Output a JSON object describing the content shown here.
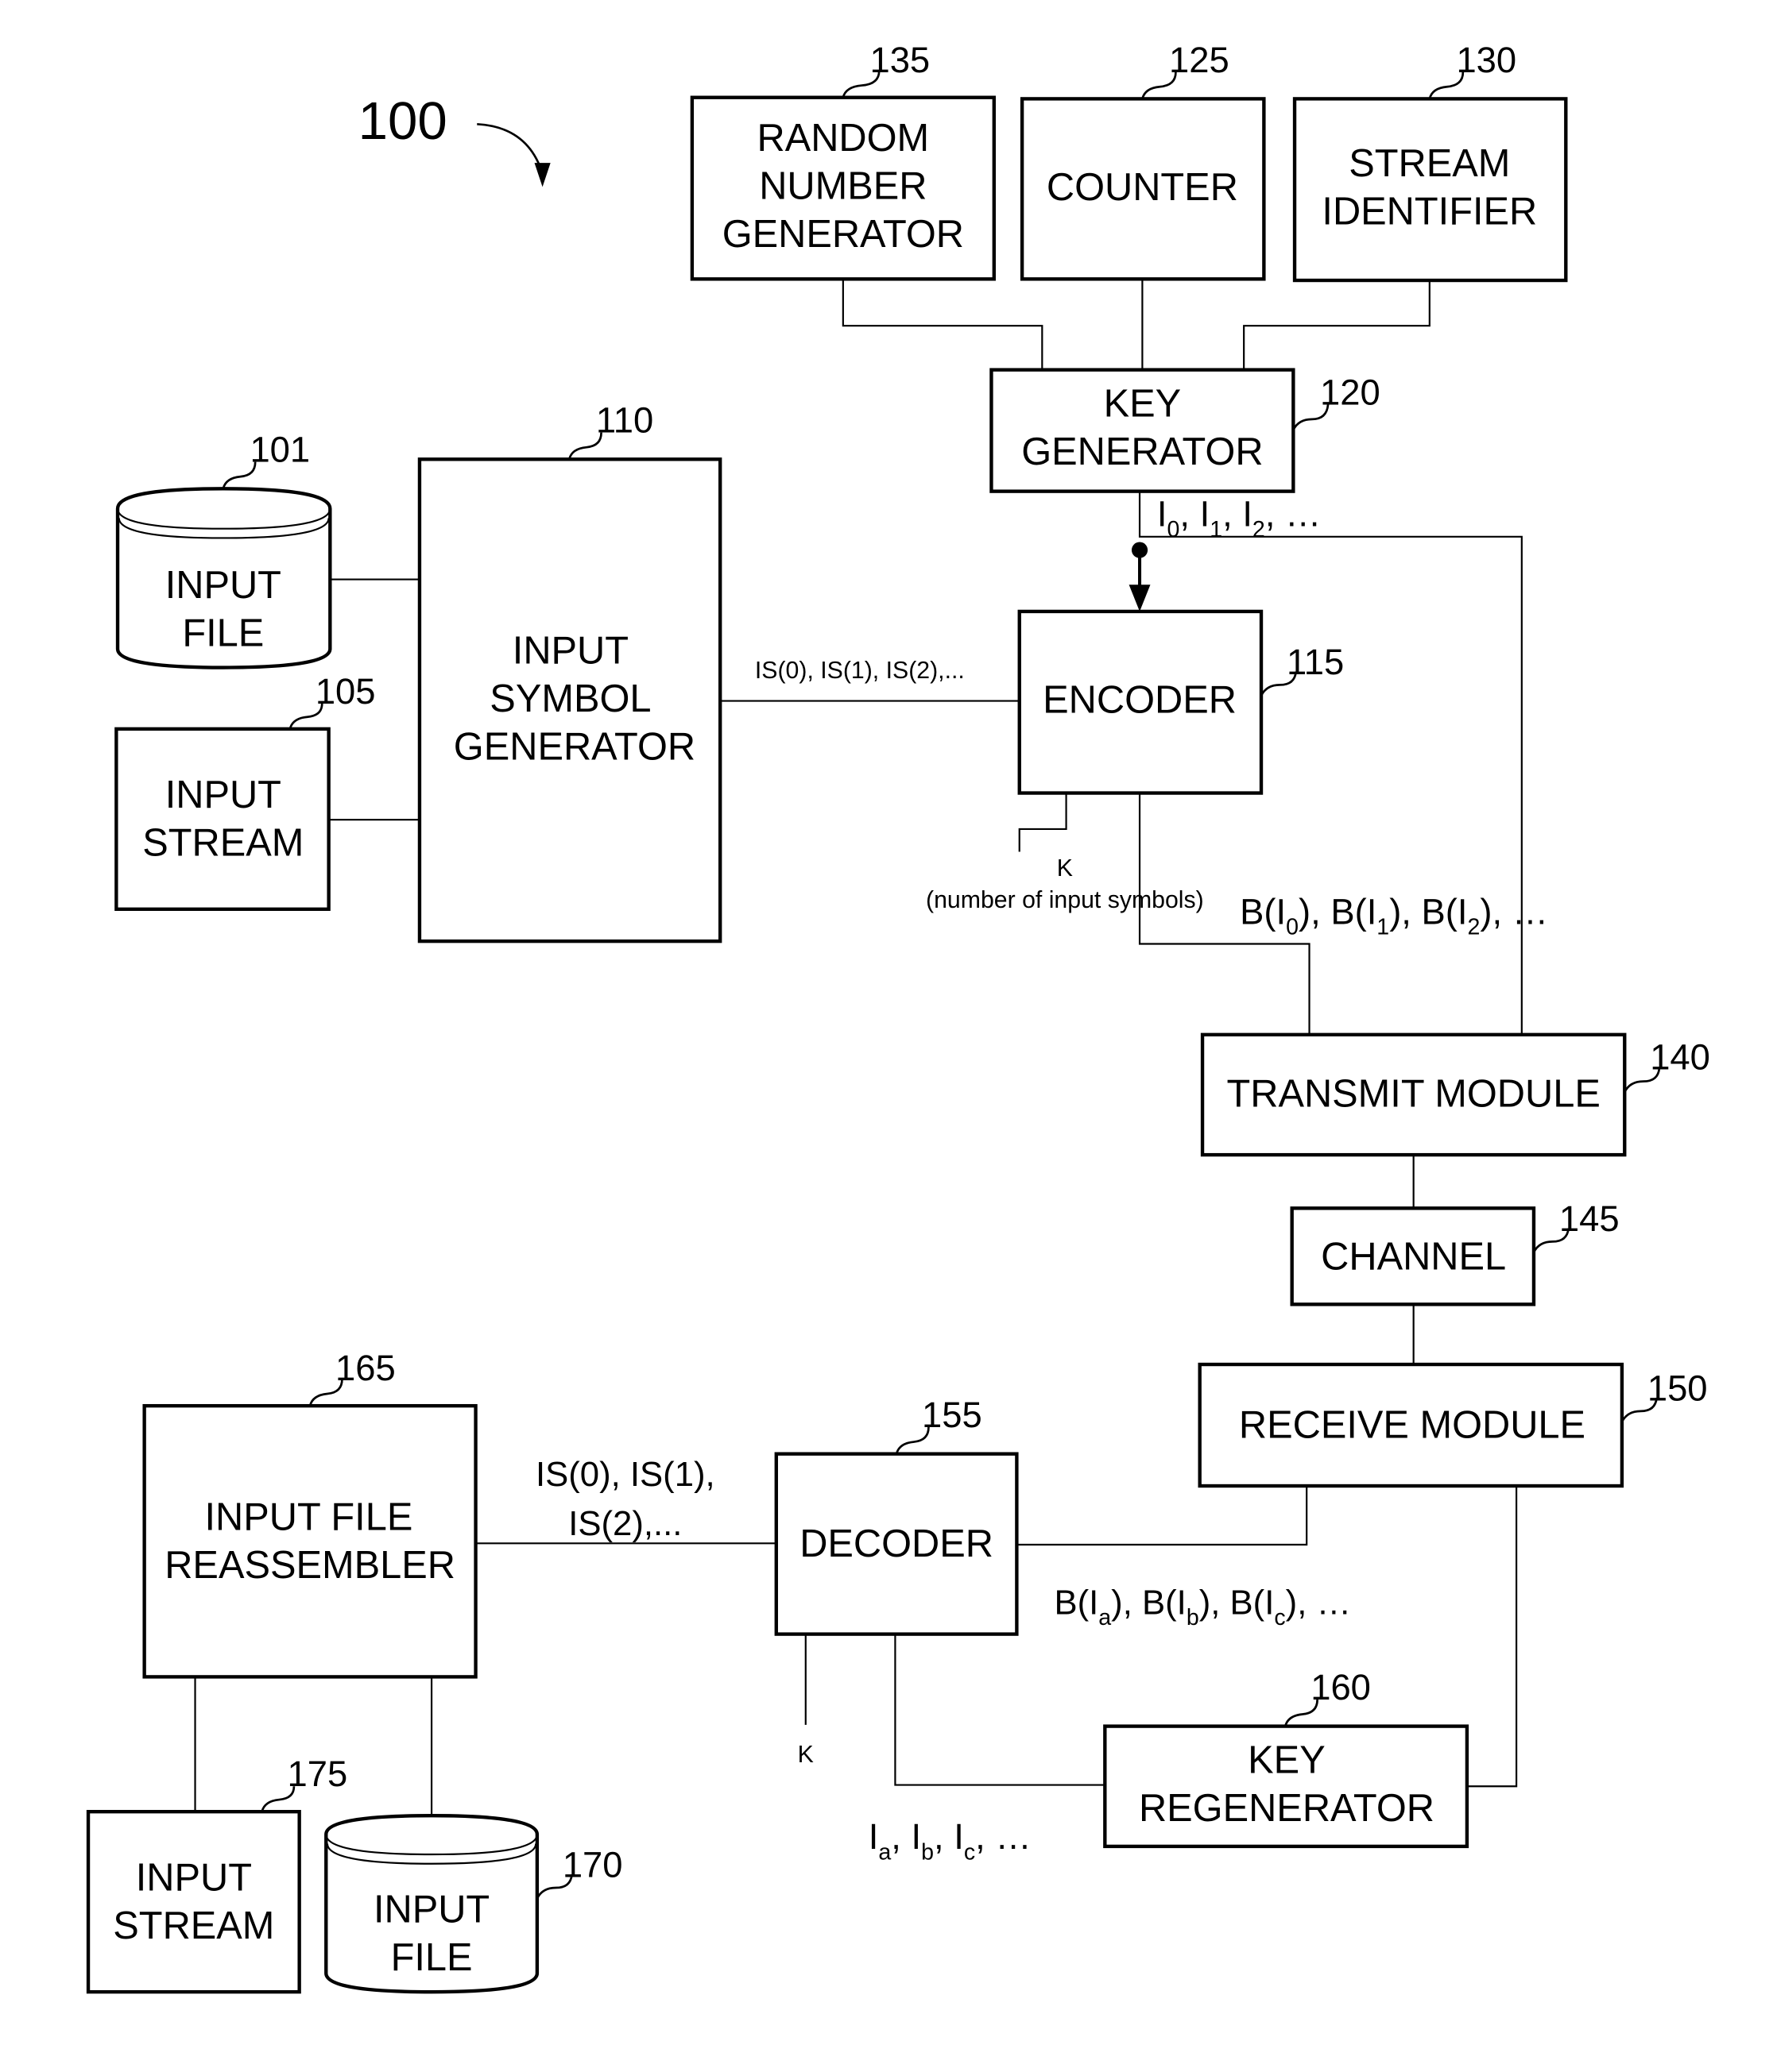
{
  "figure": {
    "ref": "100"
  },
  "blocks": {
    "rng": {
      "ref": "135",
      "lines": [
        "RANDOM",
        "NUMBER",
        "GENERATOR"
      ]
    },
    "counter": {
      "ref": "125",
      "lines": [
        "COUNTER"
      ]
    },
    "stream_id": {
      "ref": "130",
      "lines": [
        "STREAM",
        "IDENTIFIER"
      ]
    },
    "key_gen": {
      "ref": "120",
      "lines": [
        "KEY",
        "GENERATOR"
      ]
    },
    "input_file": {
      "ref": "101",
      "lines": [
        "INPUT",
        "FILE"
      ]
    },
    "input_stream": {
      "ref": "105",
      "lines": [
        "INPUT",
        "STREAM"
      ]
    },
    "symbol_gen": {
      "ref": "110",
      "lines": [
        "INPUT",
        "SYMBOL",
        "GENERATOR"
      ]
    },
    "encoder": {
      "ref": "115",
      "lines": [
        "ENCODER"
      ]
    },
    "transmit": {
      "ref": "140",
      "lines": [
        "TRANSMIT MODULE"
      ]
    },
    "channel": {
      "ref": "145",
      "lines": [
        "CHANNEL"
      ]
    },
    "receive": {
      "ref": "150",
      "lines": [
        "RECEIVE MODULE"
      ]
    },
    "decoder": {
      "ref": "155",
      "lines": [
        "DECODER"
      ]
    },
    "key_regen": {
      "ref": "160",
      "lines": [
        "KEY",
        "REGENERATOR"
      ]
    },
    "reassembler": {
      "ref": "165",
      "lines": [
        "INPUT FILE",
        "REASSEMBLER"
      ]
    },
    "out_stream": {
      "ref": "175",
      "lines": [
        "INPUT",
        "STREAM"
      ]
    },
    "out_file": {
      "ref": "170",
      "lines": [
        "INPUT",
        "FILE"
      ]
    }
  },
  "signals": {
    "keys_tx": {
      "base": "I",
      "subs": [
        "0",
        "1",
        "2"
      ],
      "tail": "…"
    },
    "symbols_tx": "IS(0), IS(1), IS(2),...",
    "k_label": "K",
    "k_desc": "(number of input symbols)",
    "encoded": {
      "prefix": "B(I",
      "subs": [
        "0",
        "1",
        "2"
      ],
      "tail": "…"
    },
    "symbols_rx": [
      "IS(0), IS(1),",
      "IS(2),..."
    ],
    "received": {
      "subs": [
        "a",
        "b",
        "c"
      ],
      "tail": "…"
    },
    "keys_rx": {
      "subs": [
        "a",
        "b",
        "c"
      ],
      "tail": "…"
    },
    "k_rx": "K"
  }
}
